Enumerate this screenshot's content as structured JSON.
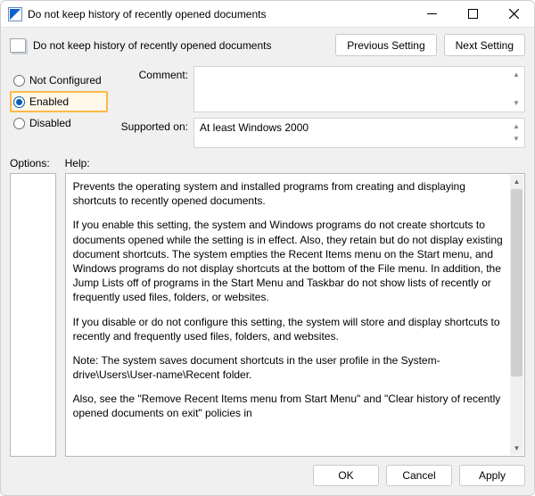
{
  "window": {
    "title": "Do not keep history of recently opened documents"
  },
  "header": {
    "title": "Do not keep history of recently opened documents",
    "prev_label": "Previous Setting",
    "next_label": "Next Setting"
  },
  "state": {
    "options": [
      {
        "label": "Not Configured"
      },
      {
        "label": "Enabled"
      },
      {
        "label": "Disabled"
      }
    ],
    "selected_index": 1,
    "highlight_index": 1
  },
  "fields": {
    "comment_label": "Comment:",
    "comment_value": "",
    "supported_label": "Supported on:",
    "supported_value": "At least Windows 2000"
  },
  "lower": {
    "options_label": "Options:",
    "help_label": "Help:"
  },
  "help": {
    "p1": "Prevents the operating system and installed programs from creating and displaying shortcuts to recently opened documents.",
    "p2": "If you enable this setting, the system and Windows programs do not create shortcuts to documents opened while the setting is in effect. Also, they retain but do not display existing document shortcuts. The system empties the Recent Items menu on the Start menu, and Windows programs do not display shortcuts at the bottom of the File menu. In addition, the Jump Lists off of programs in the Start Menu and Taskbar do not show lists of recently or frequently used files, folders, or websites.",
    "p3": "If you disable or do not configure this setting, the system will store and display shortcuts to recently and frequently used files, folders, and websites.",
    "p4": "Note: The system saves document shortcuts in the user profile in the System-drive\\Users\\User-name\\Recent folder.",
    "p5": "Also, see the \"Remove Recent Items menu from Start Menu\" and \"Clear history of recently opened documents on exit\" policies in"
  },
  "footer": {
    "ok": "OK",
    "cancel": "Cancel",
    "apply": "Apply"
  }
}
